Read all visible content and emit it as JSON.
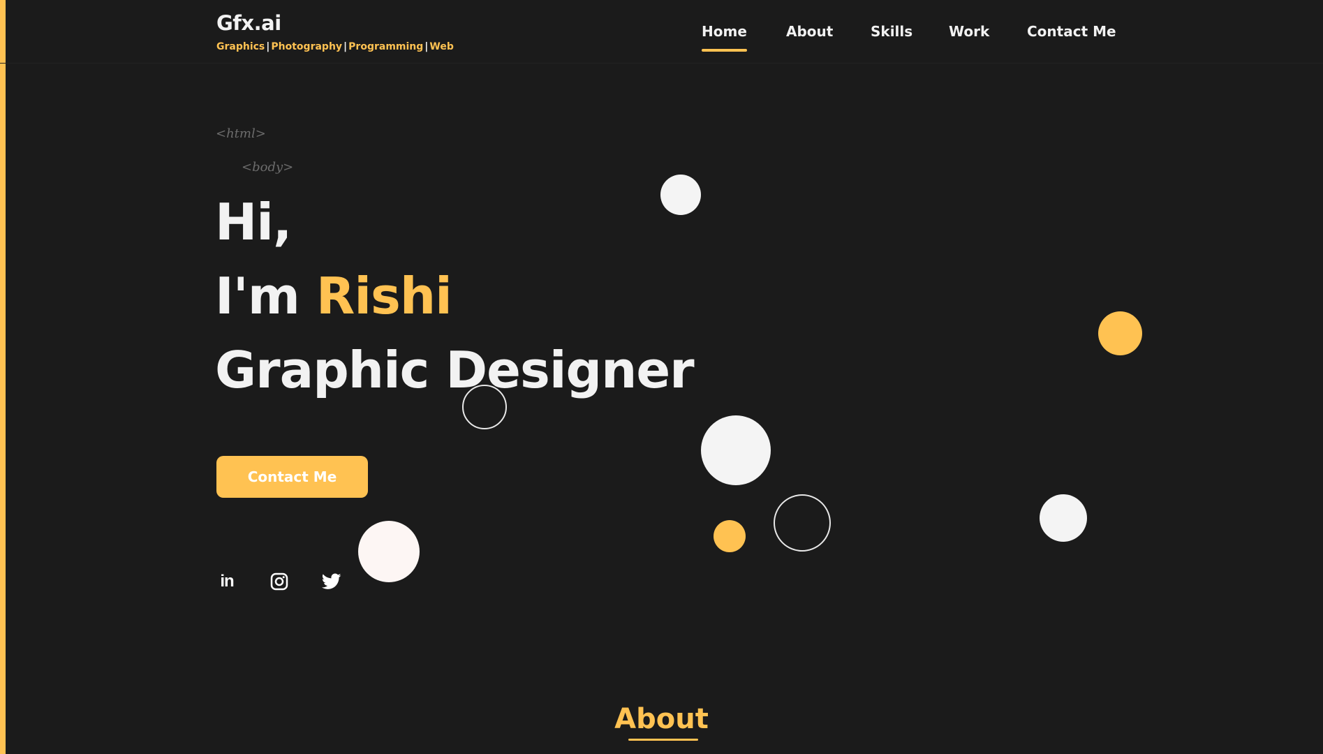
{
  "brand": {
    "title": "Gfx.ai",
    "tagline": [
      "Graphics",
      "Photography",
      "Programming",
      "Web"
    ],
    "separator": "|"
  },
  "nav": {
    "items": [
      {
        "label": "Home",
        "active": true
      },
      {
        "label": "About",
        "active": false
      },
      {
        "label": "Skills",
        "active": false
      },
      {
        "label": "Work",
        "active": false
      },
      {
        "label": "Contact Me",
        "active": false
      }
    ]
  },
  "hero": {
    "code_html": "<html>",
    "code_body": "<body>",
    "greeting": "Hi,",
    "intro_prefix": "I'm ",
    "name": "Rishi",
    "role": "Graphic Designer",
    "cta_label": "Contact Me"
  },
  "social": [
    {
      "icon": "linkedin-icon",
      "label": "in"
    },
    {
      "icon": "instagram-icon"
    },
    {
      "icon": "twitter-icon"
    }
  ],
  "about": {
    "title": "About"
  },
  "colors": {
    "accent": "#ffc252",
    "background": "#1b1b1b",
    "text": "#f2f2f2"
  }
}
